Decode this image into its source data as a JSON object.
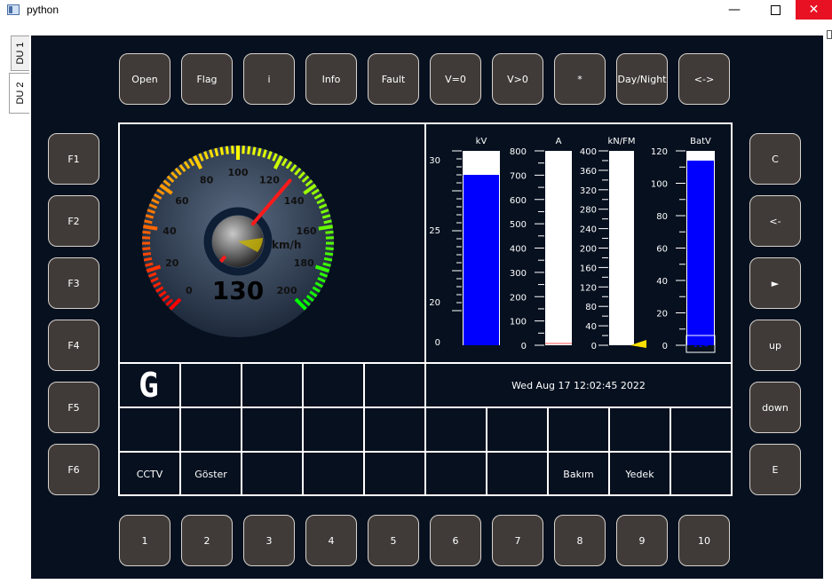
{
  "window": {
    "title": "python",
    "minimize_label": "—",
    "close_label": "✕"
  },
  "tabs": [
    {
      "label": "DU 1"
    },
    {
      "label": "DU 2"
    }
  ],
  "top_buttons": [
    "Open",
    "Flag",
    "i",
    "Info",
    "Fault",
    "V=0",
    "V>0",
    "*",
    "Day/Night",
    "<->"
  ],
  "left_buttons": [
    "F1",
    "F2",
    "F3",
    "F4",
    "F5",
    "F6"
  ],
  "right_buttons": [
    "C",
    "<-",
    "►",
    "up",
    "down",
    "E"
  ],
  "bottom_buttons": [
    "1",
    "2",
    "3",
    "4",
    "5",
    "6",
    "7",
    "8",
    "9",
    "10"
  ],
  "speedometer": {
    "value": 130,
    "max": 200,
    "unit": "km/h",
    "value_text": "130",
    "ticks": [
      "0",
      "20",
      "40",
      "60",
      "80",
      "100",
      "120",
      "140",
      "160",
      "180",
      "200"
    ]
  },
  "gauges": [
    {
      "title": "kV",
      "min": 0,
      "max": 30,
      "value": 26.3,
      "labels": [
        "30",
        "25",
        "20",
        "0"
      ],
      "color": "#0000ff"
    },
    {
      "title": "A",
      "min": 0,
      "max": 800,
      "value": 0,
      "labels": [
        "800",
        "700",
        "600",
        "500",
        "400",
        "300",
        "200",
        "100",
        "0"
      ],
      "color": "#ff3030"
    },
    {
      "title": "kN/FM",
      "min": 0,
      "max": 400,
      "value": 0,
      "labels": [
        "400",
        "360",
        "320",
        "280",
        "240",
        "200",
        "160",
        "120",
        "80",
        "40",
        "0"
      ],
      "color": "#ffff00"
    },
    {
      "title": "BatV",
      "min": 0,
      "max": 120,
      "value": 114,
      "labels": [
        "120",
        "100",
        "80",
        "60",
        "40",
        "20",
        "0"
      ],
      "color": "#0000ff",
      "readout": "114"
    }
  ],
  "status": {
    "gear": "G",
    "datetime": "Wed Aug 17 12:02:45 2022",
    "bottom_row_labels": [
      "CCTV",
      "Göster",
      "",
      "",
      "",
      "",
      "",
      "Bakım",
      "Yedek",
      ""
    ]
  }
}
